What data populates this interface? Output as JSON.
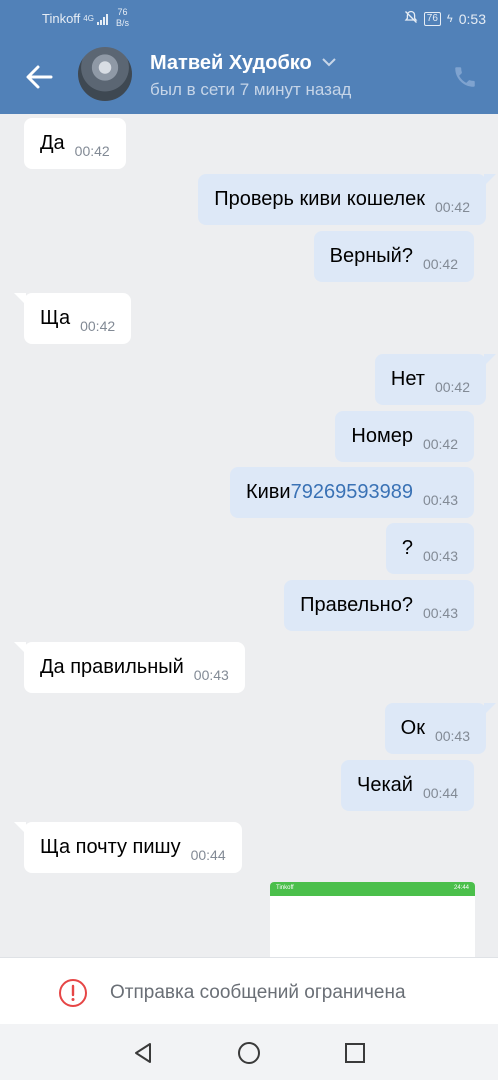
{
  "status": {
    "carrier": "Tinkoff",
    "network": "4G",
    "speed_value": "76",
    "speed_unit": "B/s",
    "battery": "76",
    "time": "0:53"
  },
  "header": {
    "name": "Матвей Худобко",
    "last_seen": "был в сети 7 минут назад"
  },
  "messages": [
    {
      "text": "Да",
      "time": "00:42",
      "dir": "in"
    },
    {
      "text": "Проверь киви кошелек",
      "time": "00:42",
      "dir": "out"
    },
    {
      "text": "Верный?",
      "time": "00:42",
      "dir": "out"
    },
    {
      "text": "Ща",
      "time": "00:42",
      "dir": "in"
    },
    {
      "text": "Нет",
      "time": "00:42",
      "dir": "out"
    },
    {
      "text": "Номер",
      "time": "00:42",
      "dir": "out"
    },
    {
      "text": "Киви ",
      "link": "79269593989",
      "time": "00:43",
      "dir": "out"
    },
    {
      "text": "?",
      "time": "00:43",
      "dir": "out"
    },
    {
      "text": "Правельно?",
      "time": "00:43",
      "dir": "out"
    },
    {
      "text": "Да правильный",
      "time": "00:43",
      "dir": "in"
    },
    {
      "text": "Ок",
      "time": "00:43",
      "dir": "out"
    },
    {
      "text": "Чекай",
      "time": "00:44",
      "dir": "out"
    },
    {
      "text": "Ща почту пишу",
      "time": "00:44",
      "dir": "in"
    }
  ],
  "attachment": {
    "carrier": "Tinkoff",
    "status_right": "24:44"
  },
  "restriction": {
    "text": "Отправка сообщений ограничена"
  },
  "colors": {
    "header": "#5181b8",
    "bubble_out": "#dde8f7",
    "bubble_in": "#ffffff",
    "background": "#edeef0",
    "link": "#3a72b5",
    "warning": "#e64646"
  },
  "icons": {
    "back": "arrow-left-icon",
    "call": "phone-icon",
    "expand": "chevron-down-icon",
    "warning": "exclamation-circle-icon",
    "nav_back": "triangle-back-icon",
    "nav_home": "circle-home-icon",
    "nav_recent": "square-recent-icon"
  }
}
